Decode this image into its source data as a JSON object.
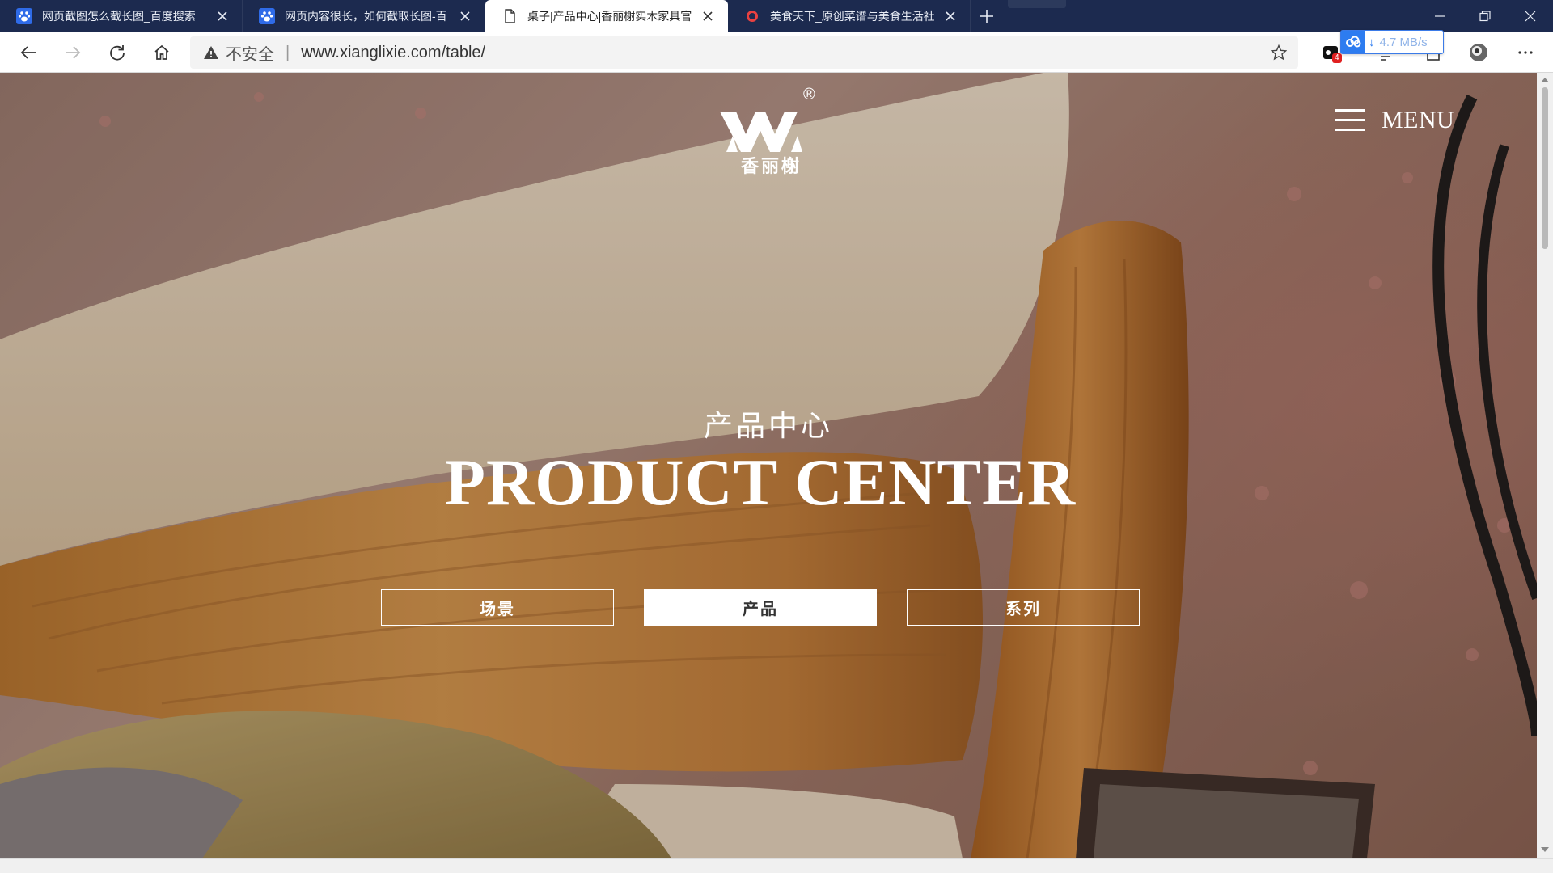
{
  "tabs": [
    {
      "title": "网页截图怎么截长图_百度搜索",
      "favicon": "baidu-paw-icon",
      "active": false
    },
    {
      "title": "网页内容很长，如何截取长图-百",
      "favicon": "baidu-paw-icon",
      "active": false
    },
    {
      "title": "桌子|产品中心|香丽榭实木家具官",
      "favicon": "page-icon",
      "active": true
    },
    {
      "title": "美食天下_原创菜谱与美食生活社",
      "favicon": "record-icon",
      "active": false
    }
  ],
  "address_bar": {
    "security_label": "不安全",
    "url": "www.xianglixie.com/table/"
  },
  "extensions": {
    "badge_count": "4",
    "download_speed": "4.7 MB/s"
  },
  "page": {
    "logo_text": "香丽榭",
    "logo_registered": "®",
    "menu_label": "MENU",
    "title_cn": "产品中心",
    "title_en": "PRODUCT CENTER",
    "categories": [
      {
        "label": "场景",
        "active": false
      },
      {
        "label": "产品",
        "active": true
      },
      {
        "label": "系列",
        "active": false
      }
    ]
  },
  "colors": {
    "tabstrip_bg": "#1c2a4f",
    "accent_blue": "#2d7cf0",
    "hero_wood": "#c98a3e",
    "hero_cream": "#ecdcc4"
  }
}
